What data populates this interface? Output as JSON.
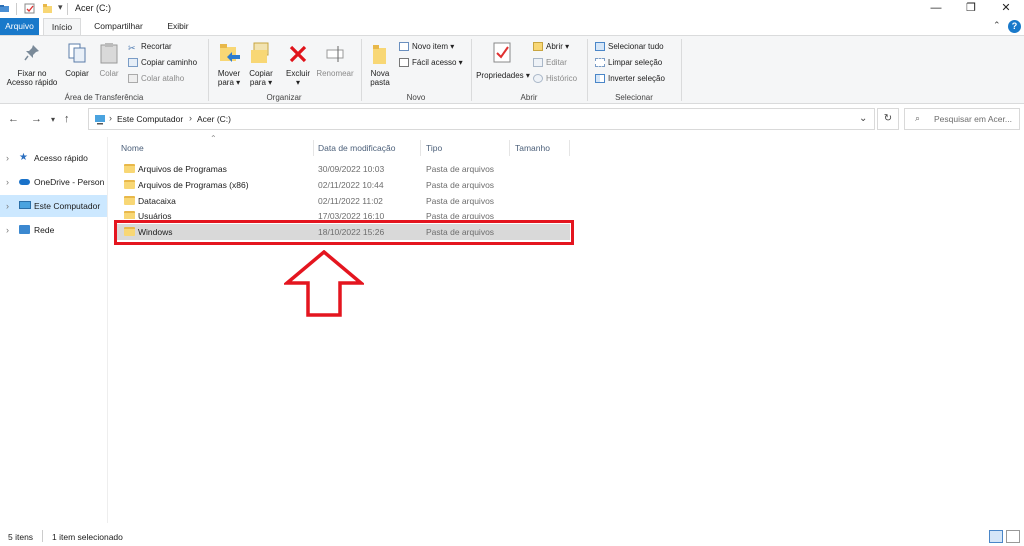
{
  "window": {
    "title": "Acer (C:)",
    "minimize": "—",
    "restore": "❐",
    "close": "✕"
  },
  "tabs": [
    {
      "label": "Arquivo"
    },
    {
      "label": "Início"
    },
    {
      "label": "Compartilhar"
    },
    {
      "label": "Exibir"
    }
  ],
  "ribbon": {
    "clipboard": {
      "pin": "Fixar no Acesso rápido",
      "copy": "Copiar",
      "paste": "Colar",
      "cut": "Recortar",
      "copy_path": "Copiar caminho",
      "paste_shortcut": "Colar atalho",
      "group": "Área de Transferência"
    },
    "organize": {
      "move": "Mover para ▾",
      "copy_to": "Copiar para ▾",
      "delete": "Excluir ▾",
      "rename": "Renomear",
      "group": "Organizar"
    },
    "new": {
      "new_folder": "Nova pasta",
      "new_item": "Novo item ▾",
      "easy_access": "Fácil acesso ▾",
      "group": "Novo"
    },
    "open": {
      "properties": "Propriedades ▾",
      "open": "Abrir ▾",
      "edit": "Editar",
      "history": "Histórico",
      "group": "Abrir"
    },
    "select": {
      "select_all": "Selecionar tudo",
      "select_none": "Limpar seleção",
      "invert": "Inverter seleção",
      "group": "Selecionar"
    }
  },
  "address": {
    "crumbs": [
      "Este Computador",
      "Acer (C:)"
    ],
    "search_placeholder": "Pesquisar em Acer..."
  },
  "nav": [
    {
      "label": "Acesso rápido",
      "icon": "star-icon"
    },
    {
      "label": "OneDrive - Person",
      "icon": "cloud-icon"
    },
    {
      "label": "Este Computador",
      "icon": "computer-icon",
      "selected": true
    },
    {
      "label": "Rede",
      "icon": "network-icon"
    }
  ],
  "columns": {
    "name": "Nome",
    "date": "Data de modificação",
    "type": "Tipo",
    "size": "Tamanho"
  },
  "files": [
    {
      "name": "Arquivos de Programas",
      "date": "30/09/2022 10:03",
      "type": "Pasta de arquivos"
    },
    {
      "name": "Arquivos de Programas (x86)",
      "date": "02/11/2022 10:44",
      "type": "Pasta de arquivos"
    },
    {
      "name": "Datacaixa",
      "date": "02/11/2022 11:02",
      "type": "Pasta de arquivos"
    },
    {
      "name": "Usuários",
      "date": "17/03/2022 16:10",
      "type": "Pasta de arquivos"
    },
    {
      "name": "Windows",
      "date": "18/10/2022 15:26",
      "type": "Pasta de arquivos",
      "selected": true
    }
  ],
  "status": {
    "count": "5 itens",
    "selection": "1 item selecionado"
  },
  "colors": {
    "accent": "#1979ca",
    "highlight": "#e4151f",
    "selected_row": "#d9d9d9",
    "nav_selected": "#cce8ff"
  }
}
